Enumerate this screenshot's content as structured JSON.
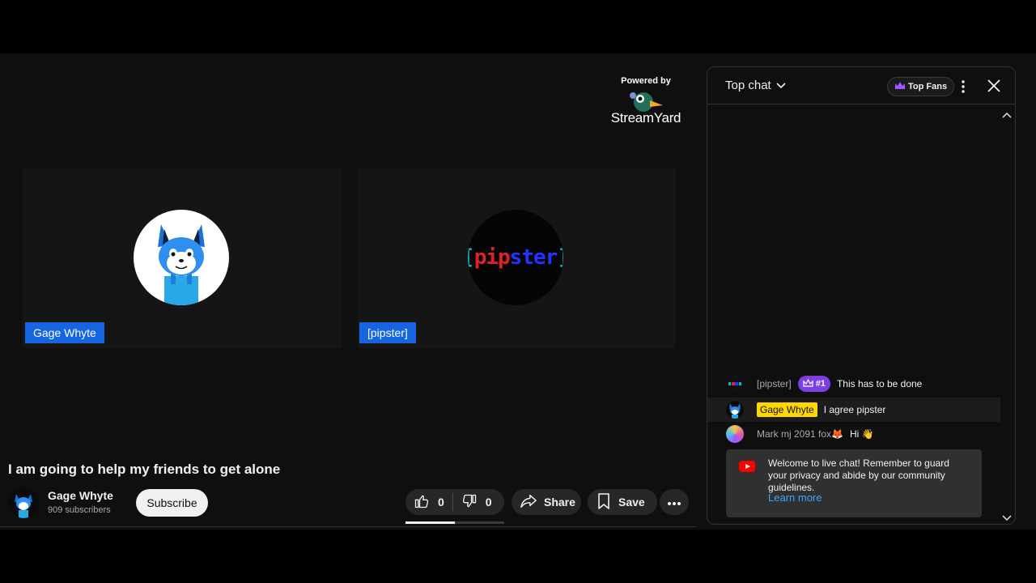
{
  "video": {
    "powered_by": "Powered by",
    "brand": "StreamYard",
    "participants": [
      {
        "name": "Gage Whyte"
      },
      {
        "name": "[pipster]",
        "logo": {
          "open": "[",
          "part1": "pip",
          "part2": "ster",
          "close": "]"
        }
      }
    ]
  },
  "info": {
    "title": "I am going to help my friends to get alone",
    "channel_name": "Gage Whyte",
    "subscribers": "909 subscribers",
    "subscribe_label": "Subscribe",
    "likes": "0",
    "dislikes": "0",
    "share_label": "Share",
    "save_label": "Save",
    "progress_fraction": 0.5
  },
  "chat": {
    "mode_label": "Top chat",
    "top_fans_label": "Top Fans",
    "messages": [
      {
        "author": "[pipster]",
        "badge": "#1",
        "text": "This has to be done"
      },
      {
        "author": "Gage Whyte",
        "text": "I agree pipster"
      },
      {
        "author": "Mark mj 2091 fox🦊",
        "text": "Hi 👋"
      }
    ],
    "welcome": {
      "text": "Welcome to live chat! Remember to guard your privacy and abide by our community guidelines.",
      "link": "Learn more"
    }
  },
  "colors": {
    "name_tag": "#1565e0",
    "owner_badge": "#ffd600",
    "member_badge": "#7b3fe4",
    "link": "#3ea6ff"
  }
}
